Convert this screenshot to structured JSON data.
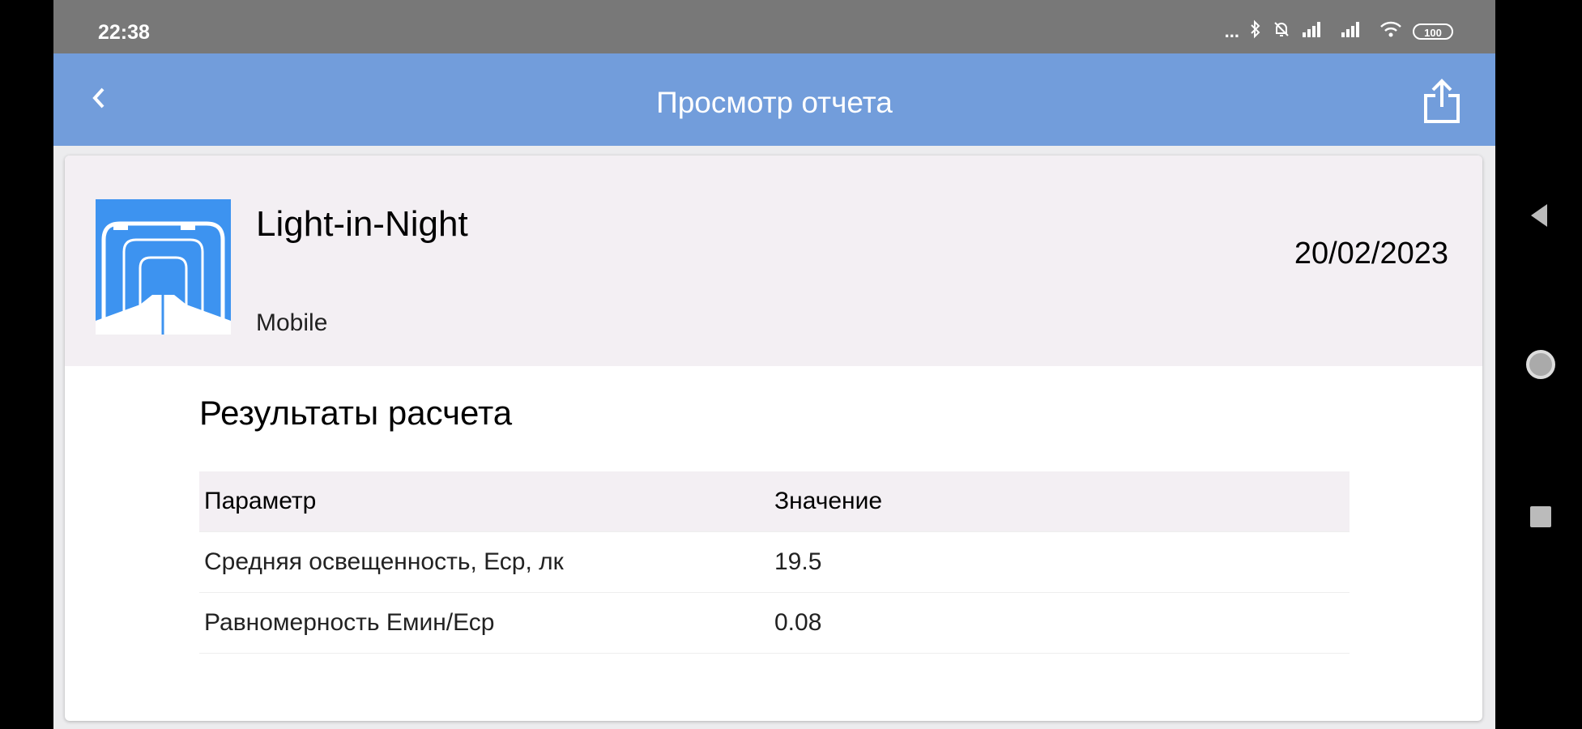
{
  "status_bar": {
    "time": "22:38",
    "dots": "...",
    "battery": "100"
  },
  "app_bar": {
    "title": "Просмотр отчета"
  },
  "report": {
    "title": "Light-in-Night",
    "subtitle": "Mobile",
    "date": "20/02/2023"
  },
  "results": {
    "title": "Результаты расчета",
    "headers": {
      "param": "Параметр",
      "value": "Значение"
    },
    "rows": [
      {
        "param": "Средняя освещенность, Еср, лк",
        "value": "19.5"
      },
      {
        "param": "Равномерность Емин/Еср",
        "value": "0.08"
      }
    ]
  },
  "colors": {
    "app_bar": "#729ddb",
    "status_bar": "#787878",
    "header_bg": "#f3eff3",
    "logo_bg": "#3d93f0"
  },
  "icons": [
    "back-arrow-icon",
    "share-icon",
    "bluetooth-icon",
    "mute-icon",
    "signal-icon",
    "wifi-icon",
    "battery-icon",
    "nav-back-icon",
    "nav-home-icon",
    "nav-recents-icon"
  ]
}
